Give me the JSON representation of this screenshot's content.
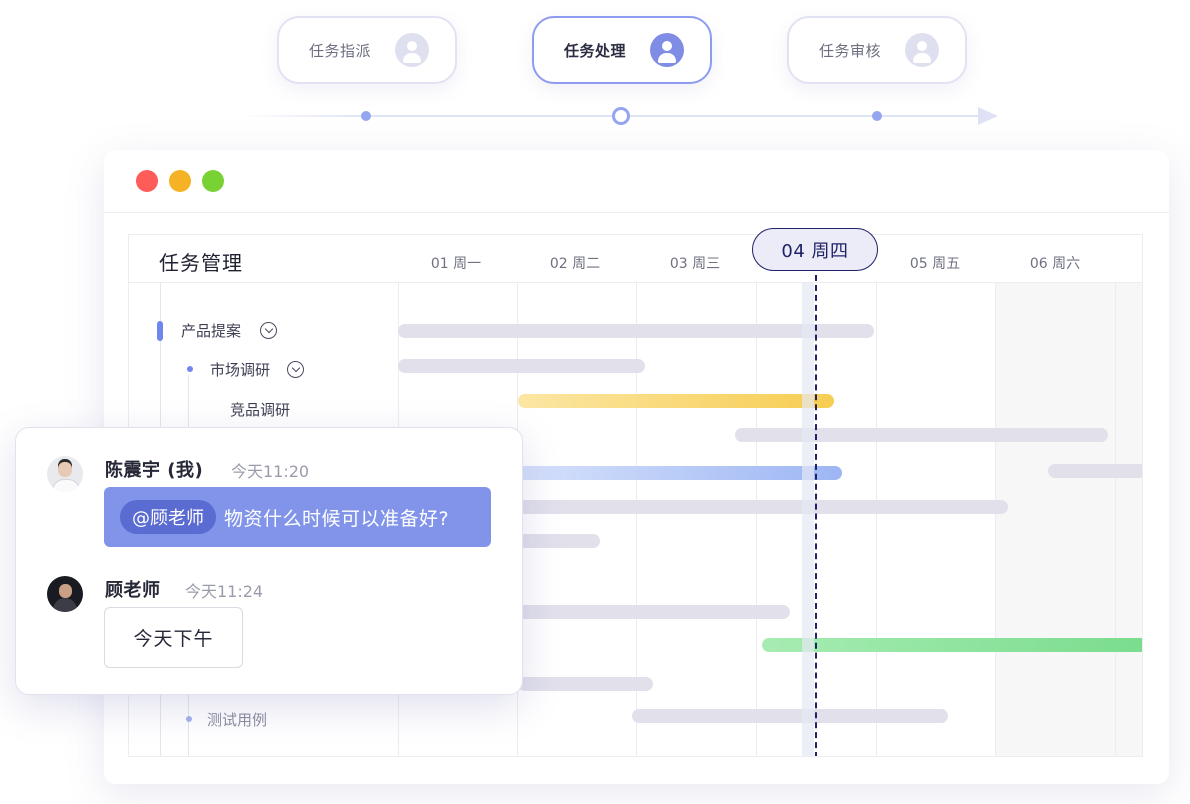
{
  "workflow": {
    "steps": [
      {
        "label": "任务指派",
        "active": false
      },
      {
        "label": "任务处理",
        "active": true
      },
      {
        "label": "任务审核",
        "active": false
      }
    ]
  },
  "window": {
    "controls": {
      "close_color": "#fd5c59",
      "minimize_color": "#f5b224",
      "maximize_color": "#79d234"
    }
  },
  "gantt": {
    "title": "任务管理",
    "days": [
      "01 周一",
      "02 周二",
      "03 周三",
      "04 周四",
      "05 周五",
      "06 周六"
    ],
    "today_label": "04 周四",
    "tasks": [
      {
        "label": "产品提案",
        "level": 0,
        "expandable": true
      },
      {
        "label": "市场调研",
        "level": 1,
        "expandable": true
      },
      {
        "label": "竞品调研",
        "level": 2,
        "expandable": false
      },
      {
        "label": "测试用例",
        "level": 1,
        "expandable": false
      }
    ]
  },
  "chat": {
    "messages": [
      {
        "sender": "陈震宇 (我)",
        "time": "今天11:20",
        "mention": "@顾老师",
        "text": "物资什么时候可以准备好?"
      },
      {
        "sender": "顾老师",
        "time": "今天11:24",
        "text": "今天下午"
      }
    ]
  },
  "colors": {
    "accent": "#8194ea",
    "today_marker": "#1f2266",
    "bar_gray": "#e1e0eb",
    "bar_yellow": "#f7cd52",
    "bar_blue": "#9db6f4",
    "bar_green": "#78dc8b"
  }
}
